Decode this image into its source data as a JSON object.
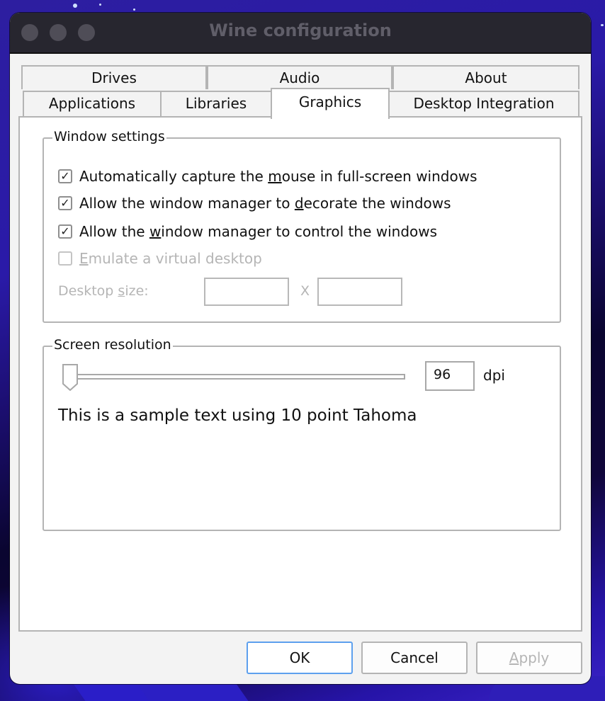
{
  "window": {
    "title": "Wine configuration"
  },
  "tabs": {
    "row_back": [
      {
        "label": "Drives"
      },
      {
        "label": "Audio"
      },
      {
        "label": "About"
      }
    ],
    "row_front": [
      {
        "label": "Applications"
      },
      {
        "label": "Libraries"
      },
      {
        "label": "Graphics",
        "active": true
      },
      {
        "label": "Desktop Integration"
      }
    ]
  },
  "window_settings": {
    "group_label": "Window settings",
    "options": [
      {
        "pre": "Automatically capture the ",
        "mnemonic": "m",
        "post": "ouse in full-screen windows",
        "checked": true,
        "enabled": true
      },
      {
        "pre": "Allow the window manager to ",
        "mnemonic": "d",
        "post": "ecorate the windows",
        "checked": true,
        "enabled": true
      },
      {
        "pre": "Allow the ",
        "mnemonic": "w",
        "post": "indow manager to control the windows",
        "checked": true,
        "enabled": true
      },
      {
        "pre": "",
        "mnemonic": "E",
        "post": "mulate a virtual desktop",
        "checked": false,
        "enabled": false
      }
    ],
    "desktop_size": {
      "label_pre": "Desktop ",
      "label_mnemonic": "s",
      "label_post": "ize:",
      "separator": "X",
      "width_value": "",
      "height_value": "",
      "enabled": false
    }
  },
  "screen_resolution": {
    "group_label": "Screen resolution",
    "dpi_value": "96",
    "dpi_unit": "dpi",
    "slider_fraction": 0.0,
    "sample_text": "This is a sample text using 10 point Tahoma"
  },
  "buttons": {
    "ok": "OK",
    "cancel": "Cancel",
    "apply_mnemonic": "A",
    "apply_post": "pply",
    "apply_enabled": false
  },
  "icons": {
    "check": "✓"
  }
}
